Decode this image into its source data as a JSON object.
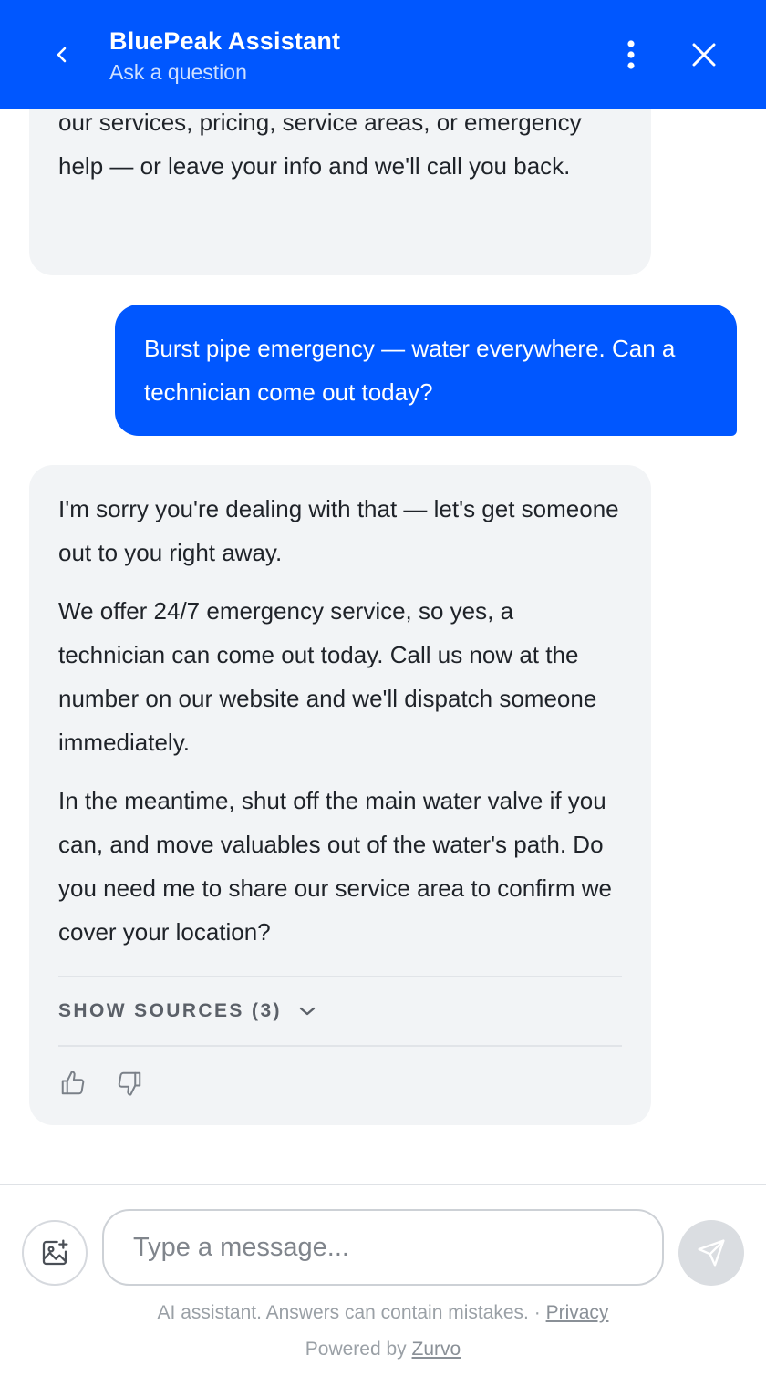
{
  "header": {
    "title": "BluePeak Assistant",
    "subtitle": "Ask a question",
    "back_icon": "chevron-left-icon",
    "menu_icon": "more-vertical-icon",
    "close_icon": "close-icon",
    "bg_color": "#0057ff"
  },
  "messages": [
    {
      "role": "assistant",
      "paragraphs": [
        "our services, pricing, service areas, or emergency help — or leave your info and we'll call you back."
      ]
    },
    {
      "role": "user",
      "text": "Burst pipe emergency — water everywhere. Can a technician come out today?"
    },
    {
      "role": "assistant",
      "paragraphs": [
        "I'm sorry you're dealing with that — let's get someone out to you right away.",
        "We offer 24/7 emergency service, so yes, a technician can come out today. Call us now at the number on our website and we'll dispatch someone immediately.",
        "In the meantime, shut off the main water valve if you can, and move valuables out of the water's path. Do you need me to share our service area to confirm we cover your location?"
      ],
      "sources_label": "SHOW SOURCES (3)",
      "feedback_icons": [
        "thumbs-up-icon",
        "thumbs-down-icon"
      ]
    }
  ],
  "composer": {
    "placeholder": "Type a message...",
    "value": "",
    "attach_icon": "image-add-icon",
    "send_icon": "send-icon"
  },
  "footer": {
    "disclaimer": "AI assistant. Answers can contain mistakes. ·",
    "privacy_link": "Privacy",
    "powered_prefix": "Powered by",
    "powered_link": "Zurvo"
  }
}
